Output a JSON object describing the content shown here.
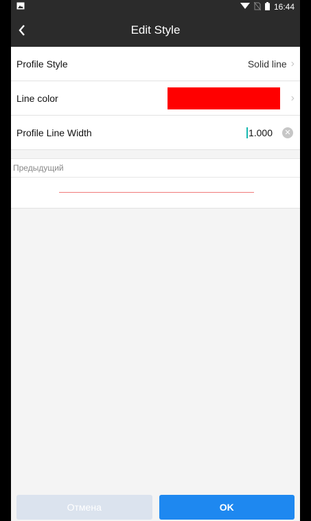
{
  "status_bar": {
    "time": "16:44"
  },
  "app_bar": {
    "title": "Edit Style"
  },
  "rows": {
    "profile_style": {
      "label": "Profile Style",
      "value": "Solid line"
    },
    "line_color": {
      "label": "Line color",
      "color": "#ff0000"
    },
    "line_width": {
      "label": "Profile Line Width",
      "value": "1.000"
    }
  },
  "preview": {
    "label": "Предыдущий",
    "line_color": "#f07a7a"
  },
  "buttons": {
    "cancel": "Отмена",
    "ok": "OK"
  },
  "colors": {
    "bar": "#2b2b2b",
    "accent": "#1e88f0",
    "cancel_bg": "#dbe3ee",
    "selected_line": "#ff0000"
  }
}
